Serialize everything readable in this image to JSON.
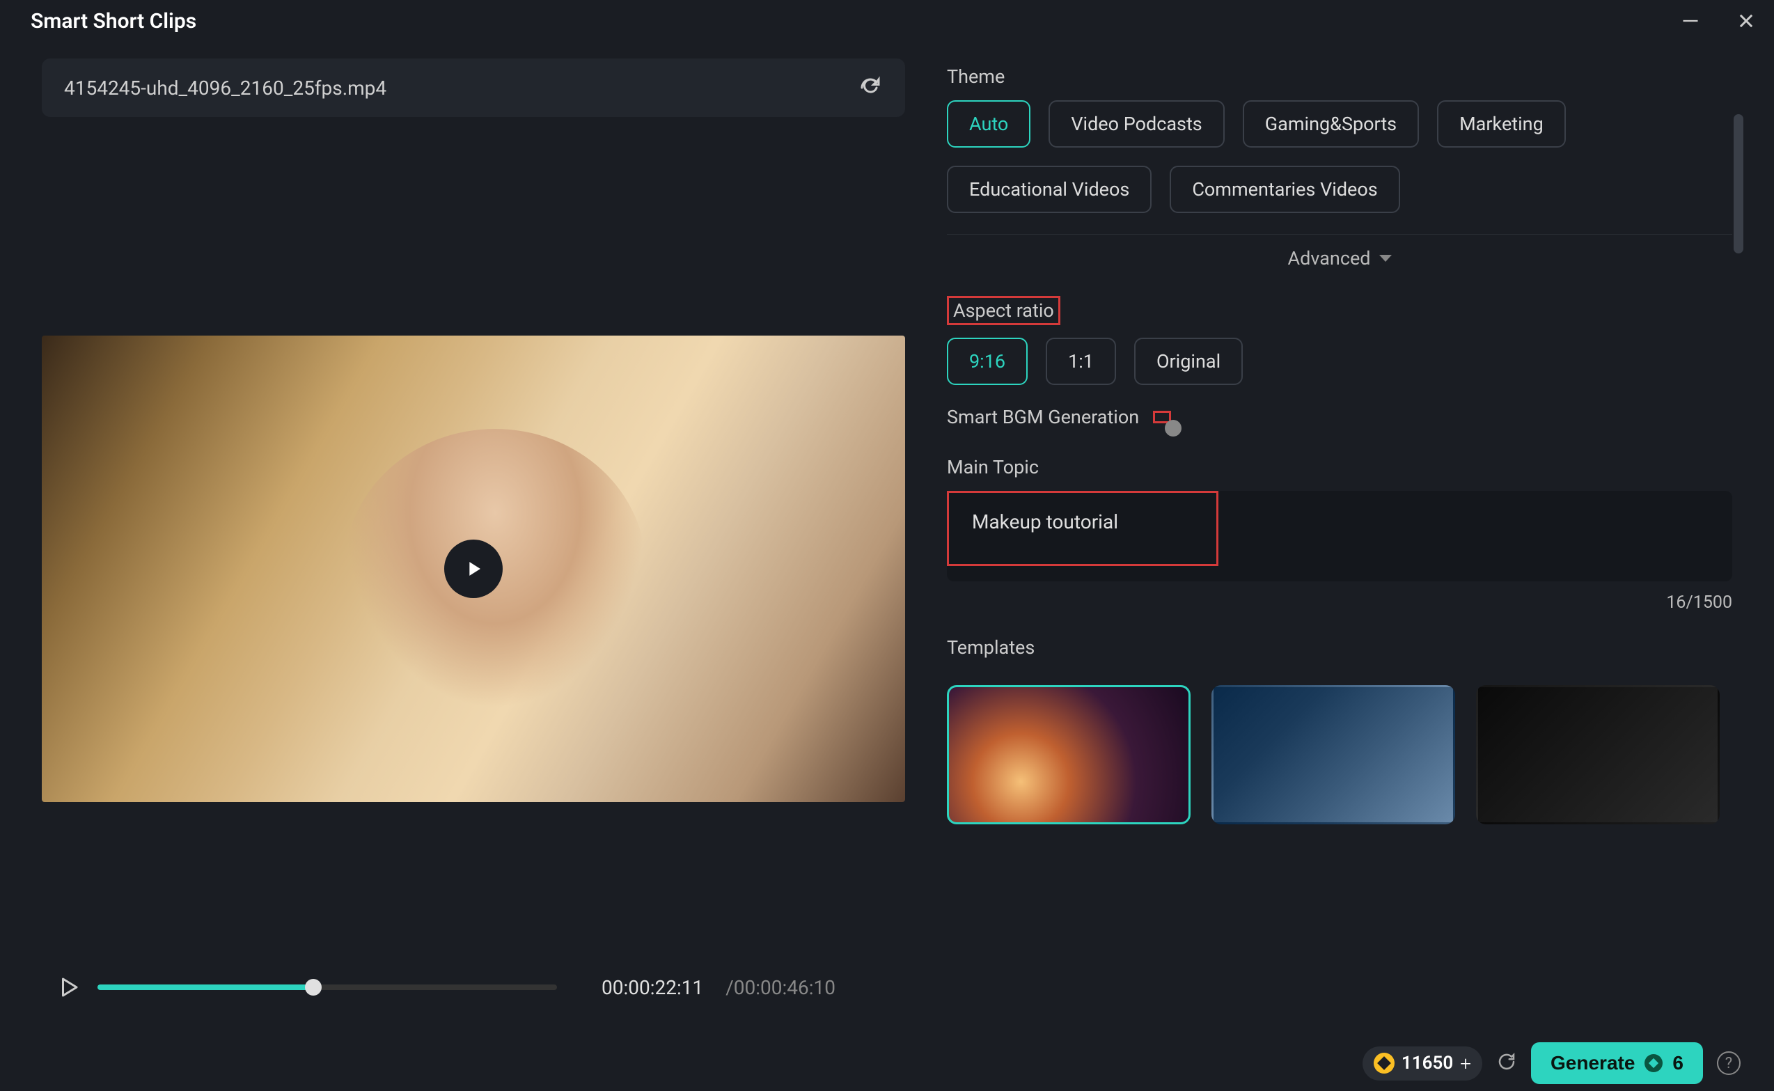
{
  "window": {
    "title": "Smart Short Clips"
  },
  "file": {
    "name": "4154245-uhd_4096_2160_25fps.mp4"
  },
  "player": {
    "current_time": "00:00:22:11",
    "total_time": "/00:00:46:10"
  },
  "theme": {
    "label": "Theme",
    "options": [
      "Auto",
      "Video Podcasts",
      "Gaming&Sports",
      "Marketing",
      "Educational Videos",
      "Commentaries Videos"
    ],
    "selected": "Auto"
  },
  "advanced": {
    "label": "Advanced"
  },
  "aspect_ratio": {
    "label": "Aspect ratio",
    "options": [
      "9:16",
      "1:1",
      "Original"
    ],
    "selected": "9:16"
  },
  "bgm": {
    "label": "Smart BGM Generation",
    "enabled": false
  },
  "main_topic": {
    "label": "Main Topic",
    "value": "Makeup toutorial",
    "char_count": "16/1500"
  },
  "templates": {
    "label": "Templates"
  },
  "footer": {
    "credits": "11650",
    "generate_label": "Generate",
    "generate_cost": "6"
  }
}
